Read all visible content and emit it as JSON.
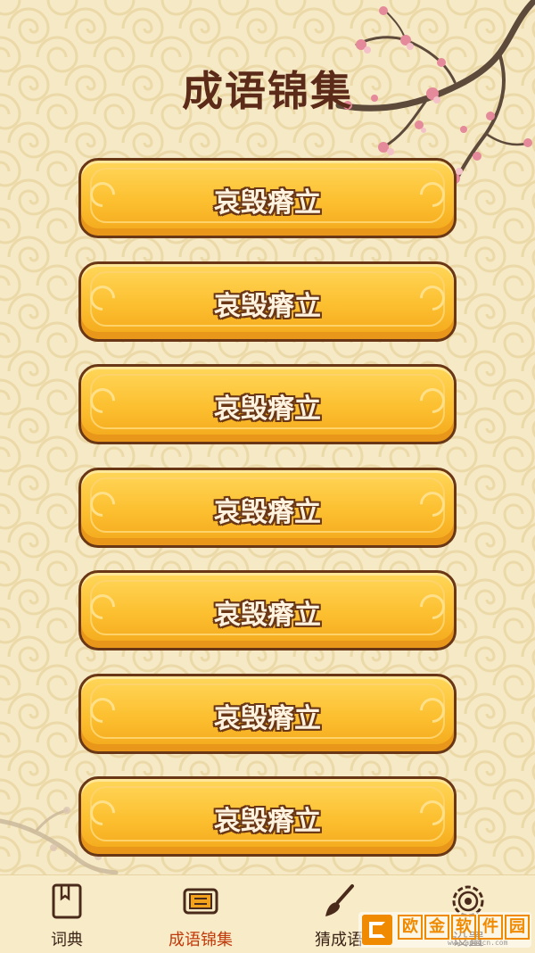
{
  "header": {
    "title": "成语锦集"
  },
  "idioms": [
    {
      "label": "哀毁瘠立"
    },
    {
      "label": "哀毁瘠立"
    },
    {
      "label": "哀毁瘠立"
    },
    {
      "label": "哀毁瘠立"
    },
    {
      "label": "哀毁瘠立"
    },
    {
      "label": "哀毁瘠立"
    },
    {
      "label": "哀毁瘠立"
    }
  ],
  "tabbar": {
    "active_index": 1,
    "tabs": [
      {
        "label": "词典",
        "icon": "book-icon"
      },
      {
        "label": "成语锦集",
        "icon": "scroll-icon"
      },
      {
        "label": "猜成语",
        "icon": "brush-icon"
      },
      {
        "label": "设置",
        "icon": "flower-settings-icon"
      }
    ]
  },
  "watermark": {
    "chars": [
      "欧",
      "金",
      "软",
      "件",
      "园"
    ],
    "url": "www.apeqcn.com"
  },
  "colors": {
    "accent": "#c0390b",
    "button_fill": "#fcbf2f",
    "button_border": "#6a3716",
    "title": "#5b2a18",
    "background": "#f6e9c6"
  }
}
